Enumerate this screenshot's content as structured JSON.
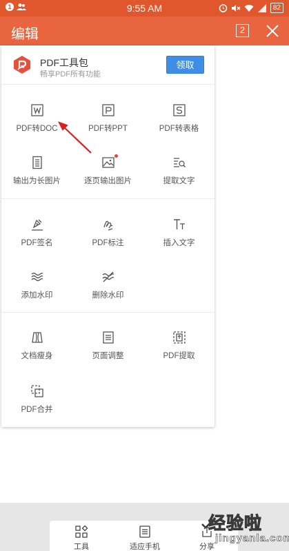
{
  "status_bar": {
    "time": "9:55 AM",
    "battery": "82",
    "notif_count": "1"
  },
  "app_bar": {
    "title": "编辑",
    "page_count": "2"
  },
  "promo": {
    "title": "PDF工具包",
    "subtitle": "畅享PDF所有功能",
    "button": "领取"
  },
  "tools": {
    "pdf_to_doc": "PDF转DOC",
    "pdf_to_ppt": "PDF转PPT",
    "pdf_to_excel": "PDF转表格",
    "export_long_image": "输出为长图片",
    "export_page_images": "逐页输出图片",
    "extract_text": "提取文字",
    "pdf_sign": "PDF签名",
    "pdf_annotate": "PDF标注",
    "insert_text": "插入文字",
    "add_watermark": "添加水印",
    "remove_watermark": "删除水印",
    "slim_document": "文档瘦身",
    "page_adjust": "页面调整",
    "pdf_extract": "PDF提取",
    "pdf_merge": "PDF合并"
  },
  "bottom_bar": {
    "tools": "工具",
    "fit_phone": "适应手机",
    "share": "分享"
  },
  "watermark": {
    "main": "经验啦",
    "sub": "jingyanla.com"
  },
  "colors": {
    "status_bar": "#e0572e",
    "app_bar": "#e8653f",
    "button": "#3f8ee6",
    "arrow": "#d9211e"
  }
}
